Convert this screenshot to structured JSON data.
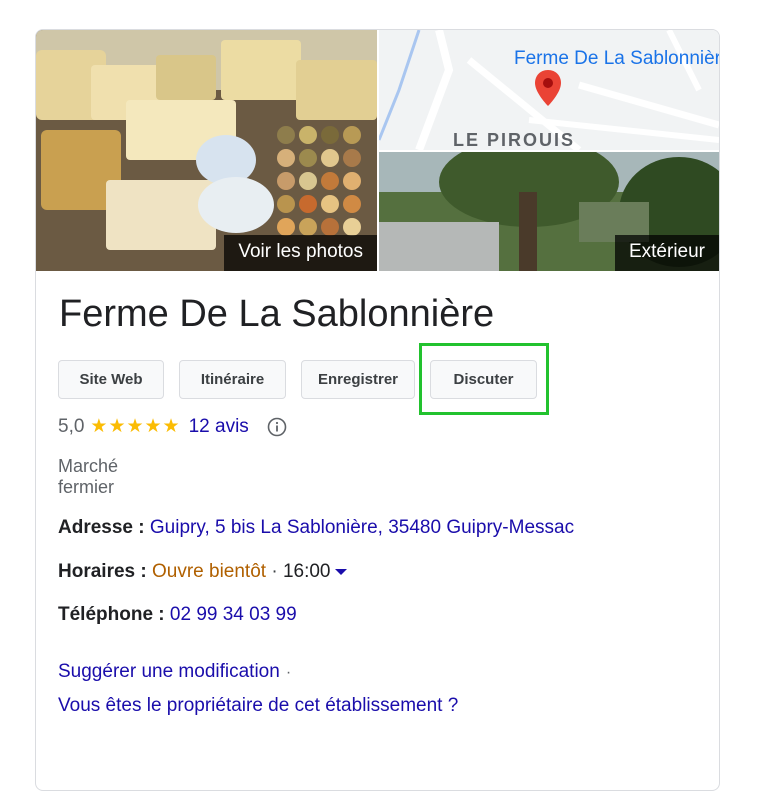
{
  "photos": {
    "main_label": "Voir les photos",
    "map_place_label": "Ferme De La Sablonnière",
    "map_area_label": "LE PIROUIS",
    "exterior_label": "Extérieur"
  },
  "business": {
    "name": "Ferme De La Sablonnière",
    "category": "Marché fermier"
  },
  "actions": {
    "website": "Site Web",
    "directions": "Itinéraire",
    "save": "Enregistrer",
    "chat": "Discuter"
  },
  "rating": {
    "value": "5,0",
    "stars": "★★★★★",
    "reviews": "12 avis"
  },
  "details": {
    "address_label": "Adresse :",
    "address_value": "Guipry, 5 bis La Sablonière, 35480 Guipry-Messac",
    "hours_label": "Horaires :",
    "hours_status": "Ouvre bientôt",
    "hours_sep": "·",
    "hours_time": "16:00",
    "phone_label": "Téléphone :",
    "phone_value": "02 99 34 03 99"
  },
  "links": {
    "suggest": "Suggérer une modification",
    "suggest_sep": "·",
    "owner": "Vous êtes le propriétaire de cet établissement ?"
  },
  "colors": {
    "link": "#1a0dab",
    "star": "#fbbc04",
    "open_soon": "#b06000",
    "highlight": "#22c22e",
    "map_pin": "#ea4335"
  }
}
